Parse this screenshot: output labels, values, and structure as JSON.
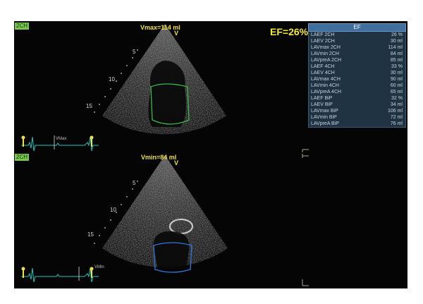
{
  "views": {
    "top": {
      "tag": "2CH",
      "title": "Vmax=114 ml",
      "apex_marker": "V",
      "depth_labels": [
        "5",
        "10",
        "15"
      ],
      "ecg_marker": "VMax"
    },
    "bottom": {
      "tag": "2CH",
      "title": "Vmin=84 ml",
      "apex_marker": "V",
      "depth_labels": [
        "5",
        "10",
        "15"
      ],
      "ecg_marker": "VMin"
    }
  },
  "ef_display": "EF=26%",
  "ef_panel": {
    "header": "EF",
    "rows": [
      {
        "label": "LAEF 2CH",
        "value": "26 %"
      },
      {
        "label": "LAEV 2CH",
        "value": "30 ml"
      },
      {
        "label": "LAVmax 2CH",
        "value": "114 ml"
      },
      {
        "label": "LAVmin 2CH",
        "value": "84 ml"
      },
      {
        "label": "LAVpreA 2CH",
        "value": "85 ml"
      },
      {
        "label": "LAEF 4CH",
        "value": "33 %"
      },
      {
        "label": "LAEV 4CH",
        "value": "30 ml"
      },
      {
        "label": "LAVmax 4CH",
        "value": "90 ml"
      },
      {
        "label": "LAVmin 4CH",
        "value": "60 ml"
      },
      {
        "label": "LAVpreA 4CH",
        "value": "65 ml"
      },
      {
        "label": "LAEF BiP",
        "value": "32 %"
      },
      {
        "label": "LAEV BiP",
        "value": "34 ml"
      },
      {
        "label": "LAVmax BiP",
        "value": "106 ml"
      },
      {
        "label": "LAVmin BiP",
        "value": "72 ml"
      },
      {
        "label": "LAVpreA BiP",
        "value": "76 ml"
      }
    ]
  },
  "colors": {
    "background": "#050505",
    "label_yellow": "#f0e040",
    "ecg_trace": "#22c4c0",
    "contour_systole": "#3ab84a",
    "contour_diastole": "#2f78e0",
    "panel_header": "#3f6f9e",
    "panel_body": "#1f3343"
  },
  "icons": [
    "sector-scale-ticks",
    "ecg-marker-icon",
    "ecg-trace",
    "frame-bracket"
  ]
}
